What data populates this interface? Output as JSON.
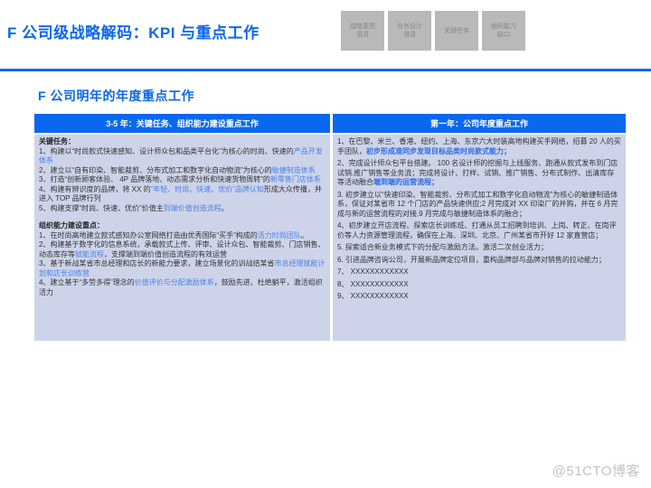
{
  "header": {
    "title": "F 公司级战略解码：KPI 与重点工作",
    "nav_boxes": [
      {
        "id": "strategy-intent",
        "label": "战略意图\n澄清"
      },
      {
        "id": "business-design",
        "label": "业务设计\n澄清"
      },
      {
        "id": "key-tasks",
        "label": "关键任务"
      },
      {
        "id": "org-capability-gap",
        "label": "组织能力\n缺口"
      }
    ]
  },
  "content": {
    "section_title": "F 公司明年的年度重点工作",
    "table": {
      "headers": [
        "3-5 年：关键任务、组织能力建设重点工作",
        "第一年：公司年度重点工作"
      ],
      "left": {
        "groups": [
          {
            "heading": "关键任务：",
            "items": [
              [
                {
                  "t": "1、构建以“时尚款式快速感知、设计师众包和品类平台化”为核心的时尚、快速的",
                  "s": "n"
                },
                {
                  "t": "产品开发体系",
                  "s": "b"
                }
              ],
              [
                {
                  "t": "2、建立以“自有印染、智能裁剪、分布式加工和数字化自动物流”为核心的",
                  "s": "n"
                },
                {
                  "t": "敏捷制造体系",
                  "s": "b"
                }
              ],
              [
                {
                  "t": "3、打造“创新顾客体验、 4P 品牌落地、动态需求分析和快速货物周转”的",
                  "s": "n"
                },
                {
                  "t": "新零售门店体系",
                  "s": "b"
                }
              ],
              [
                {
                  "t": "4、构建有辨识度的品牌，将 XX 的",
                  "s": "n"
                },
                {
                  "t": "“年轻、时尚、快速、优价”品牌认知",
                  "s": "b"
                },
                {
                  "t": "形成大众传播，并进入 TOP 品牌行列",
                  "s": "n"
                }
              ],
              [
                {
                  "t": "5、构建支撑“时尚、快速、优价”价值主",
                  "s": "n"
                },
                {
                  "t": "到端价值创造流程",
                  "s": "b"
                },
                {
                  "t": "。",
                  "s": "n"
                }
              ]
            ]
          },
          {
            "heading": "组织能力建设重点：",
            "items": [
              [
                {
                  "t": "1、在时尚高地建立款式感知办公室网络打造由优秀国际“买手”构成的",
                  "s": "n"
                },
                {
                  "t": "活力时尚团队",
                  "s": "b"
                },
                {
                  "t": "。",
                  "s": "n"
                }
              ],
              [
                {
                  "t": "2、构建基于数字化的信息系统，承载款式上传、评审、设计众包、智能裁剪、门店销售、动态库存等",
                  "s": "n"
                },
                {
                  "t": "赋能流程",
                  "s": "b"
                },
                {
                  "t": "，支撑端到端价值创造流程的有效运营",
                  "s": "n"
                }
              ],
              [
                {
                  "t": "3、基于新战某省市总经理和店长的新能力要求，建立场景化的训战结某省",
                  "s": "n"
                },
                {
                  "t": "市总经理赋能计划和店长训练营",
                  "s": "b"
                }
              ],
              [
                {
                  "t": "4、建立基于“多劳多得”理念的",
                  "s": "n"
                },
                {
                  "t": "价值评价与分配激励体系",
                  "s": "b"
                },
                {
                  "t": "，鼓励先进、杜绝躺平，激活组织活力",
                  "s": "n"
                }
              ]
            ]
          }
        ]
      },
      "right": {
        "items": [
          [
            {
              "t": "1、在巴黎、米兰、香港、纽约、上海、东京六大时装高地构建买手网络，招募 20 人的买手团队，",
              "s": "n"
            },
            {
              "t": "初步形成准同步发现目标品类时尚款式能力；",
              "s": "bb"
            }
          ],
          [
            {
              "t": "2、完成设计师众包平台搭建。 100 名设计师的挖掘与上线服务、跑通从款式发布到门店试销.推广销售等业务流；完成将设计、打样、试销、推广销售、分布式制作、出清库存等活动融合",
              "s": "n"
            },
            {
              "t": "端到端的运营流程；",
              "s": "bb"
            }
          ],
          [
            {
              "t": "3. 初步建立以“快速印染、智能裁剪、分布式加工和数字化自动物流”为核心的敏捷制造体系，保证对某省市 12 个门店的产品快速供应;2 月完成对 XX 印染厂的并购，并在 6 月完成与新的运营流程的对接,9 月完成与敏捷制造体系的融合；",
              "s": "n"
            }
          ],
          [
            {
              "t": "4、初步建立开店流程、探索店长训练班、打通从员工招聘到培训、上岗、转正、在岗评价等人力资源管理流程，确保在上海、深圳、北京、广州某省市开好 12 家直营店；",
              "s": "n"
            }
          ],
          [
            {
              "t": "5. 探索适合新业务模式下的分配与激励方法。激活二次创业活力；",
              "s": "n"
            }
          ],
          [
            {
              "t": "6. 引进品牌咨询公司，开展新品牌定位项目，重构品牌部与品牌对销售的拉动能力；",
              "s": "n"
            }
          ],
          [
            {
              "t": "7、 XXXXXXXXXXXX",
              "s": "n"
            }
          ],
          [
            {
              "t": "8、 XXXXXXXXXXXX",
              "s": "n"
            }
          ],
          [
            {
              "t": "9、 XXXXXXXXXXXX",
              "s": "n"
            }
          ]
        ]
      }
    }
  },
  "footer": {
    "watermark": "@51CTO博客"
  },
  "colors": {
    "accent_blue": "#0a68f0",
    "table_body_bg": "#cdd4e9",
    "emphasis_blue": "#4d82e8",
    "nav_box_gray": "#b9b9b9"
  }
}
